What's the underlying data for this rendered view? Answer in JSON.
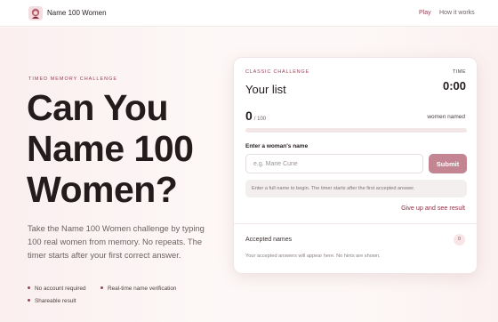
{
  "header": {
    "brand": "Name 100 Women",
    "nav": [
      {
        "label": "Play",
        "active": true
      },
      {
        "label": "How it works",
        "active": false
      }
    ]
  },
  "hero": {
    "eyebrow": "TIMED MEMORY CHALLENGE",
    "headline_lines": [
      "Can You",
      "Name 100",
      "Women?"
    ],
    "lead": "Take the Name 100 Women challenge by typing 100 real women from memory. No repeats. The timer starts after your first correct answer.",
    "features": [
      "No account required",
      "Real-time name verification",
      "Shareable result"
    ]
  },
  "card": {
    "eyebrow": "CLASSIC CHALLENGE",
    "title": "Your list",
    "time_label": "TIME",
    "time_value": "0:00",
    "count": "0",
    "count_total": "/ 100",
    "count_label": "women named",
    "progress_fraction": 0,
    "field_label": "Enter a woman's name",
    "input_value": "",
    "input_placeholder": "e.g. Marie Curie",
    "submit_label": "Submit",
    "info_text": "Enter a full name to begin. The timer starts after the first accepted answer.",
    "give_up_label": "Give up and see result",
    "accepted_title": "Accepted names",
    "accepted_count": "0",
    "accepted_empty": "Your accepted answers will appear here. No hints are shown."
  },
  "colors": {
    "accent": "#9b4356",
    "button": "#c48592",
    "text": "#241c1c"
  }
}
